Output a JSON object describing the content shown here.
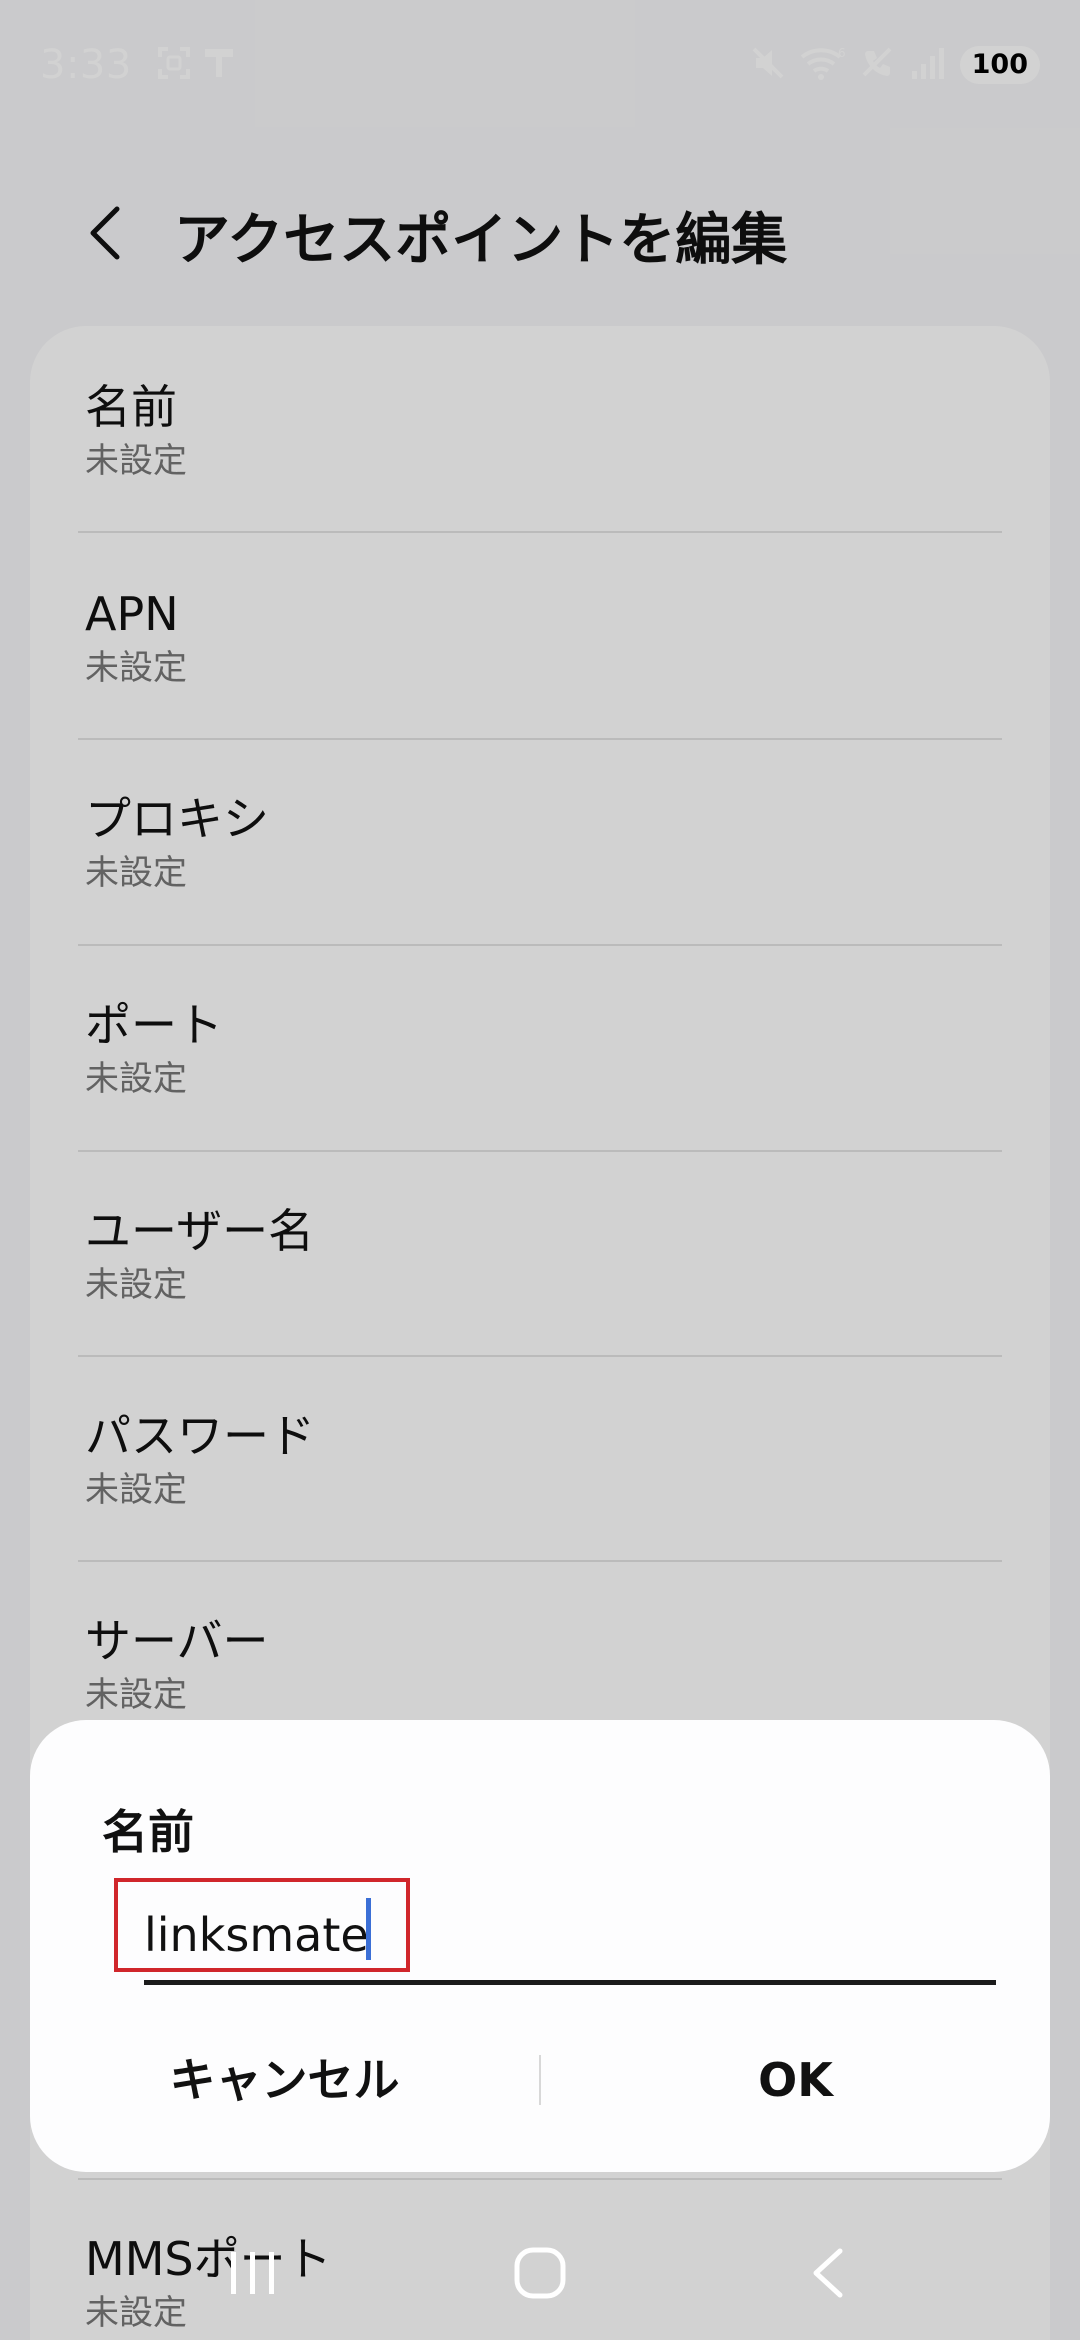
{
  "status_bar": {
    "time": "3:33",
    "battery_level": "100",
    "left_icons": [
      "screenshot-icon",
      "notification-icon"
    ],
    "right_icons": [
      "mute-icon",
      "wifi-6-icon",
      "call-disabled-icon",
      "signal-icon"
    ]
  },
  "header": {
    "back_icon": "chevron-left-icon",
    "title": "アクセスポイントを編集"
  },
  "settings": {
    "items": [
      {
        "label": "名前",
        "value": "未設定"
      },
      {
        "label": "APN",
        "value": "未設定"
      },
      {
        "label": "プロキシ",
        "value": "未設定"
      },
      {
        "label": "ポート",
        "value": "未設定"
      },
      {
        "label": "ユーザー名",
        "value": "未設定"
      },
      {
        "label": "パスワード",
        "value": "未設定"
      },
      {
        "label": "サーバー",
        "value": "未設定"
      },
      {
        "label": "MMSポート",
        "value": "未設定"
      }
    ]
  },
  "dialog": {
    "title": "名前",
    "input_value": "linksmate",
    "cancel_label": "キャンセル",
    "ok_label": "OK"
  },
  "nav": {
    "icons": [
      "recent-apps-icon",
      "home-icon",
      "back-icon"
    ]
  },
  "colors": {
    "highlight_border": "#d0262b",
    "cursor": "#3b6fd6",
    "secondary_text": "#777777"
  }
}
